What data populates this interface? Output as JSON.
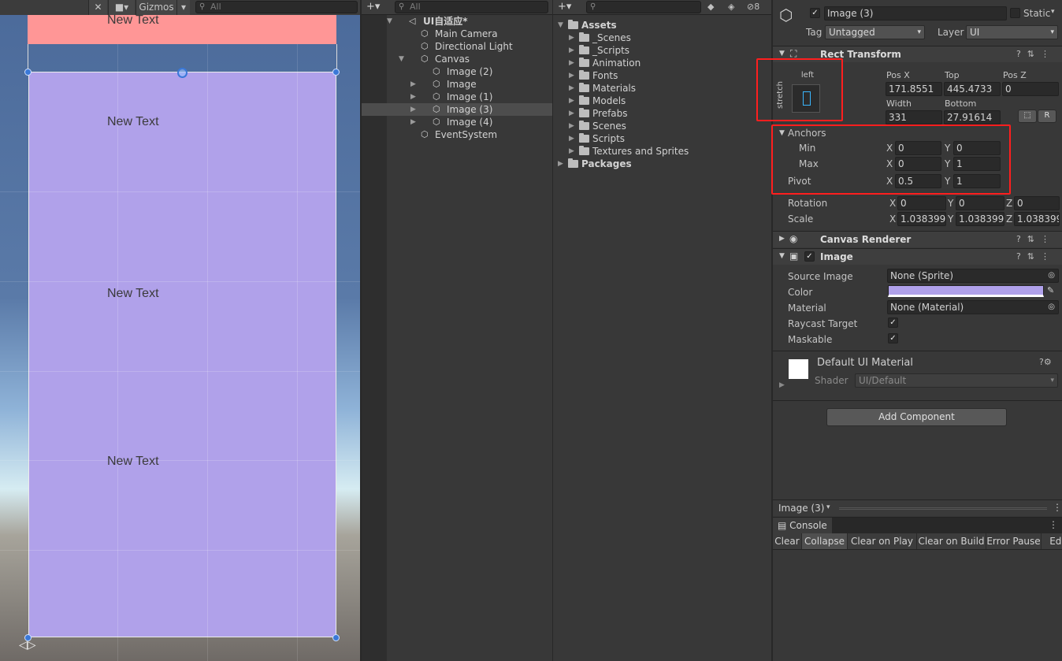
{
  "scene": {
    "toolbar": {
      "gizmos_label": "Gizmos",
      "search_placeholder": "All"
    },
    "text_labels": [
      "New Text",
      "New Text",
      "New Text",
      "New Text"
    ]
  },
  "hierarchy": {
    "search_placeholder": "All",
    "items": [
      {
        "label": "UI自适应*",
        "depth": 0,
        "expanded": true,
        "icon": "unity-scene-icon"
      },
      {
        "label": "Main Camera",
        "depth": 1,
        "icon": "gameobject-cube-icon"
      },
      {
        "label": "Directional Light",
        "depth": 1,
        "icon": "gameobject-cube-icon"
      },
      {
        "label": "Canvas",
        "depth": 1,
        "expanded": true,
        "icon": "gameobject-cube-icon"
      },
      {
        "label": "Image (2)",
        "depth": 2,
        "icon": "gameobject-cube-icon"
      },
      {
        "label": "Image",
        "depth": 2,
        "collapsed": true,
        "icon": "gameobject-cube-icon"
      },
      {
        "label": "Image (1)",
        "depth": 2,
        "collapsed": true,
        "icon": "gameobject-cube-icon"
      },
      {
        "label": "Image (3)",
        "depth": 2,
        "collapsed": true,
        "selected": true,
        "icon": "gameobject-cube-icon"
      },
      {
        "label": "Image (4)",
        "depth": 2,
        "collapsed": true,
        "icon": "gameobject-cube-icon"
      },
      {
        "label": "EventSystem",
        "depth": 1,
        "icon": "gameobject-cube-icon"
      }
    ]
  },
  "project": {
    "hidden_count": "8",
    "items": [
      {
        "label": "Assets",
        "depth": 0,
        "expanded": true,
        "bold": true
      },
      {
        "label": "_Scenes",
        "depth": 1
      },
      {
        "label": "_Scripts",
        "depth": 1
      },
      {
        "label": "Animation",
        "depth": 1
      },
      {
        "label": "Fonts",
        "depth": 1
      },
      {
        "label": "Materials",
        "depth": 1
      },
      {
        "label": "Models",
        "depth": 1
      },
      {
        "label": "Prefabs",
        "depth": 1
      },
      {
        "label": "Scenes",
        "depth": 1
      },
      {
        "label": "Scripts",
        "depth": 1
      },
      {
        "label": "Textures and Sprites",
        "depth": 1
      },
      {
        "label": "Packages",
        "depth": 0,
        "bold": true
      }
    ]
  },
  "inspector": {
    "object_name": "Image (3)",
    "static_label": "Static",
    "tag_label": "Tag",
    "tag_value": "Untagged",
    "layer_label": "Layer",
    "layer_value": "UI",
    "rect_transform": {
      "title": "Rect Transform",
      "anchor_preset_h": "left",
      "anchor_preset_v": "stretch",
      "pos_x_label": "Pos X",
      "pos_x": "171.8551",
      "top_label": "Top",
      "top": "445.4733",
      "pos_z_label": "Pos Z",
      "pos_z": "0",
      "width_label": "Width",
      "width": "331",
      "bottom_label": "Bottom",
      "bottom": "27.91614",
      "r_button": "R",
      "anchors_label": "Anchors",
      "min_label": "Min",
      "min_x": "0",
      "min_y": "0",
      "max_label": "Max",
      "max_x": "0",
      "max_y": "1",
      "pivot_label": "Pivot",
      "pivot_x": "0.5",
      "pivot_y": "1",
      "rotation_label": "Rotation",
      "rot_x": "0",
      "rot_y": "0",
      "rot_z": "0",
      "scale_label": "Scale",
      "scale_x": "1.038399",
      "scale_y": "1.038399",
      "scale_z": "1.038399",
      "axis_x": "X",
      "axis_y": "Y",
      "axis_z": "Z"
    },
    "canvas_renderer": {
      "title": "Canvas Renderer"
    },
    "image": {
      "title": "Image",
      "source_image_label": "Source Image",
      "source_image": "None (Sprite)",
      "color_label": "Color",
      "color_value": "#b0a1ea",
      "material_label": "Material",
      "material": "None (Material)",
      "raycast_label": "Raycast Target",
      "maskable_label": "Maskable"
    },
    "material_preview": {
      "title": "Default UI Material",
      "shader_label": "Shader",
      "shader_value": "UI/Default"
    },
    "add_component": "Add Component",
    "footer_object": "Image (3)"
  },
  "console": {
    "tab_label": "Console",
    "buttons": [
      "Clear",
      "Collapse",
      "Clear on Play",
      "Clear on Build",
      "Error Pause",
      "Edi"
    ]
  }
}
